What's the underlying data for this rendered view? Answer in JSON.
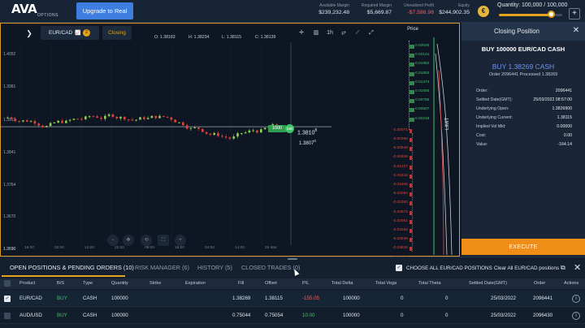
{
  "app": {
    "logo_text": "AVA",
    "logo_sub": "OPTIONS"
  },
  "header": {
    "upgrade_label": "Upgrade to Real",
    "stats": [
      {
        "label": "Available Margin",
        "value": "$239,232.48"
      },
      {
        "label": "Required Margin",
        "value": "$5,669.87"
      },
      {
        "label": "Unrealized Profit",
        "value": "-$7,586.98"
      },
      {
        "label": "Equity",
        "value": "$244,902.35"
      }
    ],
    "currency_icon": "euro-icon",
    "quantity_label": "Quantity: 100,000 / 100,000",
    "quantity_fraction": 0.82,
    "plus_label": "+"
  },
  "chart_toolbar": {
    "instrument": "EUR/CAD",
    "badge": "2",
    "closing_label": "Closing",
    "ohlc": {
      "o": "O: 1.38183",
      "h": "H: 1.38234",
      "l": "L: 1.38115",
      "c": "C: 1.38139"
    },
    "timeframe": "1h"
  },
  "chart_data": {
    "type": "candlestick",
    "ylim": [
      1.35,
      1.406
    ],
    "y_ticks": [
      "1.4052",
      "1.3981",
      "1.3911",
      "1.3841",
      "1.3764",
      "1.3670",
      "1.3600",
      "1.3510"
    ],
    "x_ticks": [
      "16:00",
      "02:00",
      "12:00",
      "22:00",
      "08:00",
      "18:00",
      "04:00",
      "14:00",
      "25 Mar"
    ],
    "position_tag": "1000",
    "price_tag_upper": "1.3810",
    "price_tag_upper_sup": "8",
    "price_tag_lower": "1.3807",
    "price_tag_lower_sup": "0",
    "entry_price": 1.38269,
    "candles_count": 70
  },
  "price_ladder": {
    "header": "Price",
    "limit_label": "LIMIT",
    "up": [
      "0.02530",
      "0.02141",
      "0.01962",
      "0.01683",
      "0.01374",
      "0.01085",
      "0.00796",
      "0.00507",
      "0.00218"
    ],
    "down": [
      "-0.00071",
      "-0.00360",
      "-0.00649",
      "-0.00938",
      "-0.01227",
      "-0.01516",
      "-0.01805",
      "-0.02094",
      "-0.02383",
      "-0.02672",
      "-0.02961",
      "-0.03250",
      "-0.03539",
      "-0.03828",
      "-0.04117",
      "-0.04406"
    ]
  },
  "closing_panel": {
    "title": "Closing Position",
    "order_title": "BUY 100000 EUR/CAD CASH",
    "buy_line": "BUY 1.38269 CASH",
    "sub_line": "Order 2096441 Processed 1.38269",
    "rows": [
      {
        "k": "Order:",
        "v": "2096441"
      },
      {
        "k": "Settled Date(GMT):",
        "v": "25/03/2022 08:57:00"
      },
      {
        "k": "Underlying Open:",
        "v": "1.3826900"
      },
      {
        "k": "Underlying Current:",
        "v": "1.38115"
      },
      {
        "k": "Implied Vol Mid:",
        "v": "0.00000"
      },
      {
        "k": "Cost:",
        "v": "0.00"
      },
      {
        "k": "Value:",
        "v": "-164.14"
      }
    ],
    "execute_label": "EXECUTE"
  },
  "bottom": {
    "tabs": [
      {
        "label": "OPEN POSITIONS & PENDING ORDERS (10)"
      },
      {
        "label": "RISK MANAGER (6)"
      },
      {
        "label": "HISTORY (5)"
      },
      {
        "label": "CLOSED TRADES (0)"
      }
    ],
    "choose_label": "CHOOSE ALL EUR/CAD POSITIONS",
    "clear_label": "Clear All EUR/CAD positions",
    "columns": [
      "Product",
      "B/S",
      "Type",
      "Quantity",
      "Strike",
      "Expiration",
      "Fill",
      "Offset",
      "P/L",
      "Total Delta",
      "Total Vega",
      "Total Theta",
      "Settled Date(GMT)",
      "Order",
      "Actions"
    ],
    "rows": [
      {
        "product": "EUR/CAD",
        "bs": "BUY",
        "type": "CASH",
        "qty": "100000",
        "strike": "",
        "exp": "",
        "fill": "1.38269",
        "offset": "1.38115",
        "pl": "-155.05",
        "delta": "100000",
        "vega": "0",
        "theta": "0",
        "settled": "25/03/2022",
        "order": "2096441",
        "checked": true
      },
      {
        "product": "AUD/USD",
        "bs": "BUY",
        "type": "CASH",
        "qty": "100000",
        "strike": "",
        "exp": "",
        "fill": "0.75044",
        "offset": "0.75054",
        "pl": "10.00",
        "delta": "100000",
        "vega": "0",
        "theta": "0",
        "settled": "25/03/2022",
        "order": "2096430",
        "checked": false
      }
    ]
  }
}
